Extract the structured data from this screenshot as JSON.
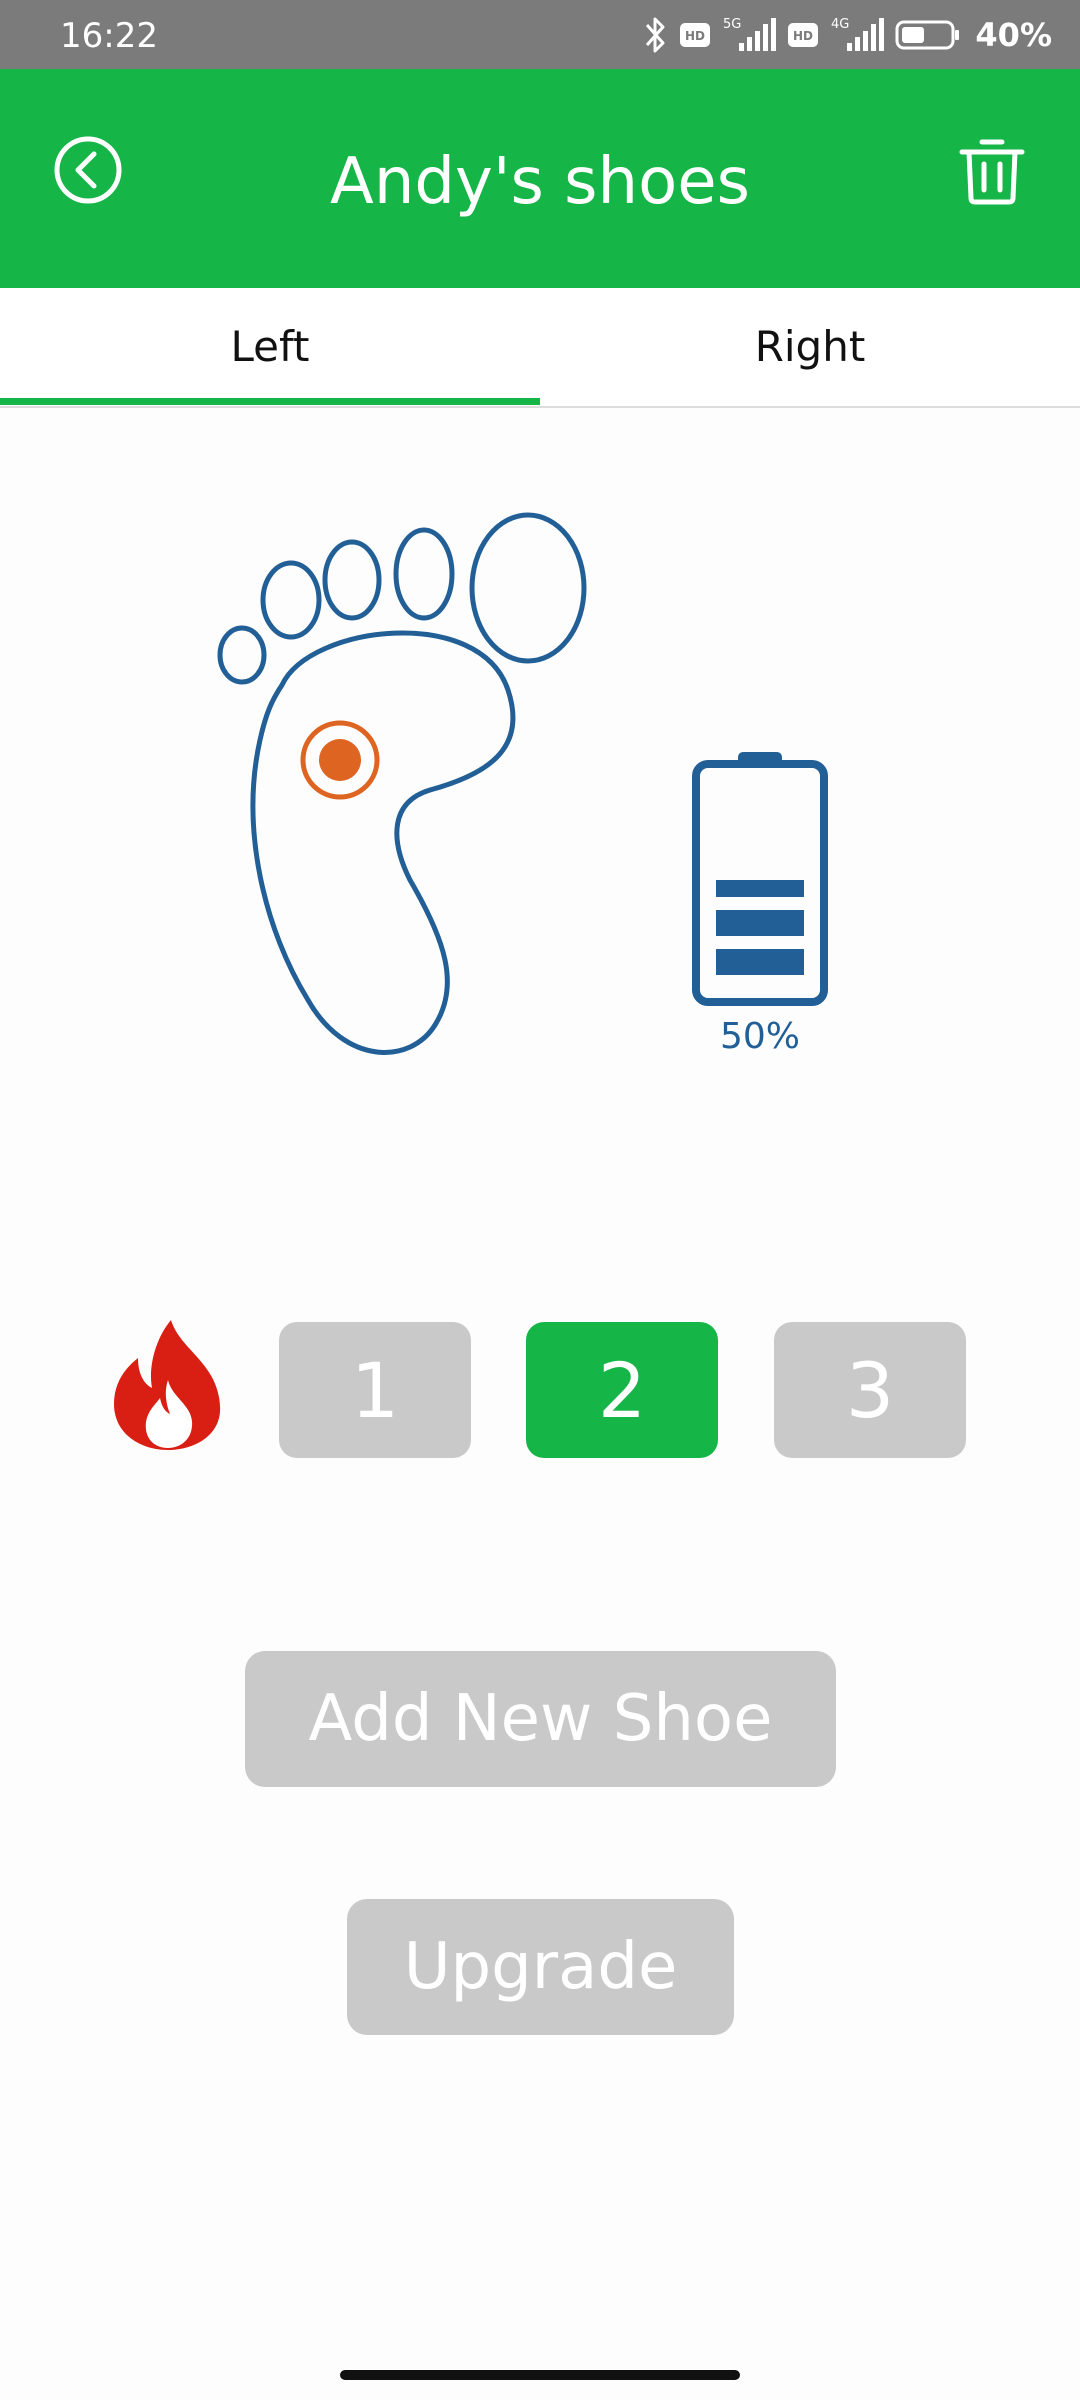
{
  "status_bar": {
    "time": "16:22",
    "network_1": "5G",
    "network_2": "4G",
    "battery": "40%",
    "icons": [
      "bluetooth-icon",
      "hd-icon",
      "signal-icon",
      "hd-icon",
      "signal-icon",
      "battery-icon"
    ]
  },
  "header": {
    "title": "Andy's shoes",
    "back_icon": "back-circle-icon",
    "delete_icon": "trash-icon",
    "background_color": "#16b548"
  },
  "tabs": [
    {
      "label": "Left",
      "selected": true
    },
    {
      "label": "Right",
      "selected": false
    }
  ],
  "device": {
    "foot_icon": "foot-outline-icon",
    "heat_point_icon": "target-dot-icon",
    "battery_icon": "battery-icon",
    "battery_level": 0.5,
    "battery_label": "50%",
    "accent_color": "#215f96",
    "heat_point_color": "#dd6421"
  },
  "heat_levels": {
    "icon": "fire-icon",
    "options": [
      "1",
      "2",
      "3"
    ],
    "selected": "2",
    "active_color": "#16b548",
    "inactive_color": "#c9c9c9"
  },
  "actions": {
    "add_new_shoe": "Add New Shoe",
    "upgrade": "Upgrade"
  }
}
